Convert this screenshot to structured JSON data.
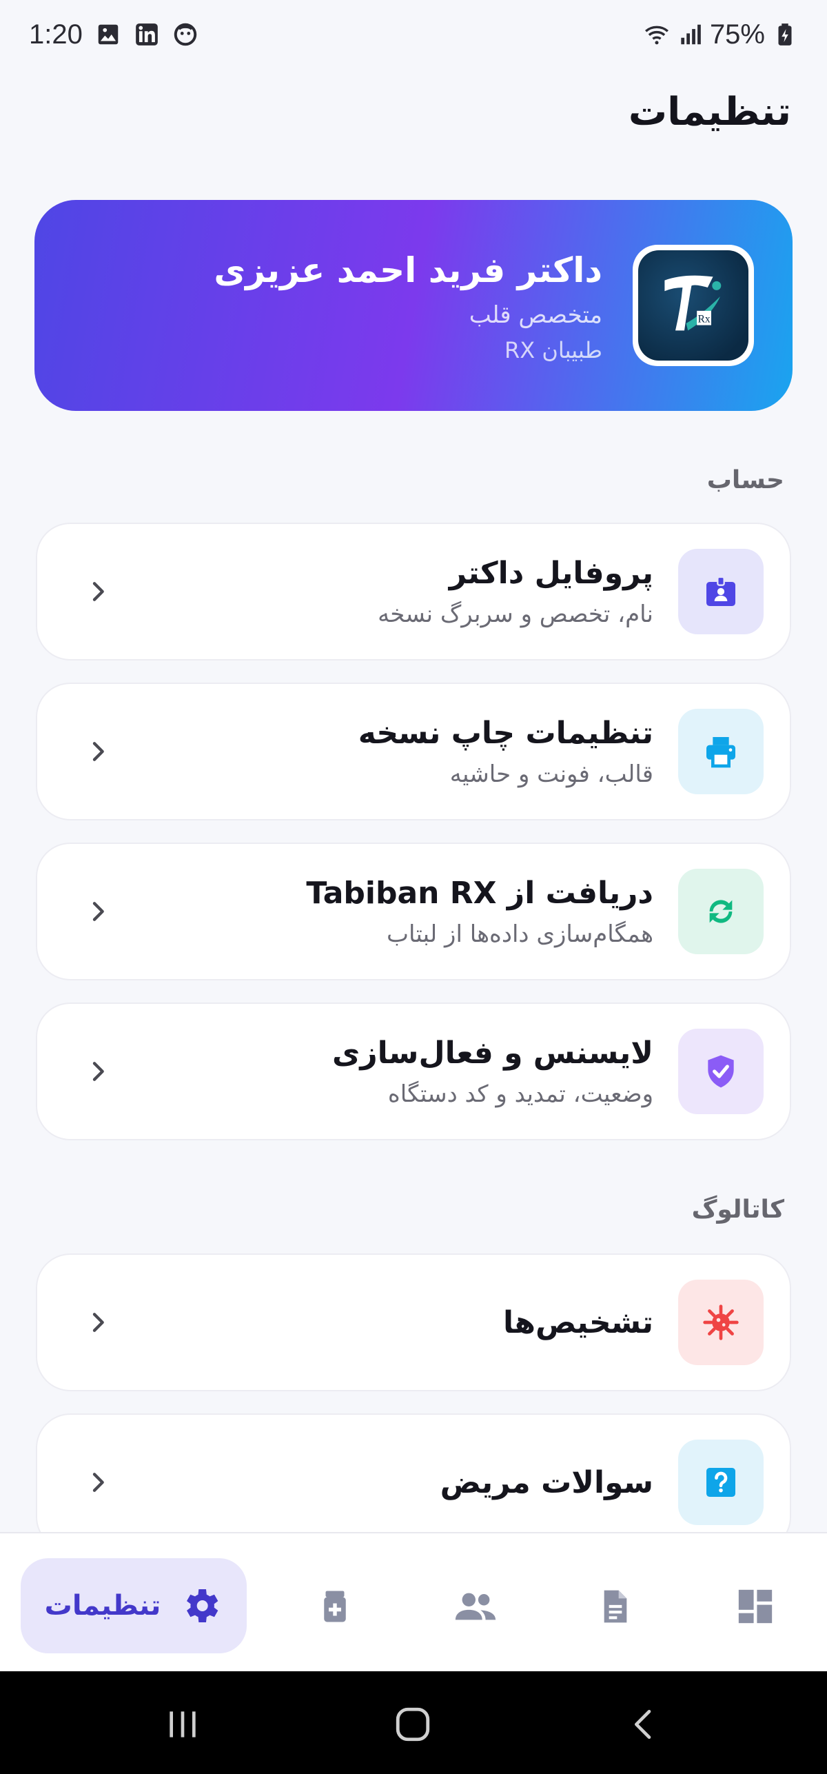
{
  "status_bar": {
    "time": "1:20",
    "battery": "75%",
    "icons": [
      "image-icon",
      "linkedin-icon",
      "face-icon",
      "wifi-icon",
      "signal-icon",
      "battery-icon"
    ]
  },
  "page": {
    "title": "تنظیمات"
  },
  "profile": {
    "name": "داکتر فرید احمد عزیزی",
    "specialty": "متخصص قلب",
    "app_name": "طبیبان RX"
  },
  "sections": {
    "account": "حساب",
    "catalog": "کاتالوگ"
  },
  "account_items": [
    {
      "title": "پروفایل داکتر",
      "subtitle": "نام، تخصص و سربرگ نسخه",
      "icon": "id-badge-icon",
      "bg": "#e6e5fb",
      "fg": "#4f46e5"
    },
    {
      "title": "تنظیمات چاپ نسخه",
      "subtitle": "قالب، فونت و حاشیه",
      "icon": "printer-icon",
      "bg": "#e1f3fb",
      "fg": "#0ea5e9"
    },
    {
      "title": "دریافت از Tabiban RX",
      "subtitle": "همگام‌سازی داده‌ها از لبتاب",
      "icon": "sync-icon",
      "bg": "#e0f5ec",
      "fg": "#10b981"
    },
    {
      "title": "لایسنس و فعال‌سازی",
      "subtitle": "وضعیت، تمدید و کد دستگاه",
      "icon": "shield-check-icon",
      "bg": "#ede6fc",
      "fg": "#8b5cf6"
    }
  ],
  "catalog_items": [
    {
      "title": "تشخیص‌ها",
      "icon": "virus-icon",
      "bg": "#fde6e6",
      "fg": "#ef4444"
    },
    {
      "title": "سوالات مریض",
      "icon": "question-icon",
      "bg": "#e1f3fb",
      "fg": "#0ea5e9"
    }
  ],
  "bottom_nav": {
    "active_label": "تنظیمات",
    "items": [
      "gear-icon",
      "medicine-icon",
      "users-icon",
      "document-icon",
      "dashboard-icon"
    ]
  }
}
